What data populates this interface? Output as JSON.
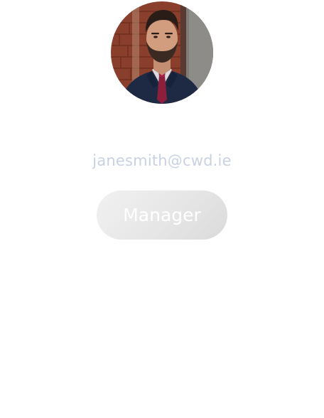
{
  "profile": {
    "avatar_icon": "person-portrait-icon",
    "email": "janesmith@cwd.ie",
    "role_label": "Manager"
  },
  "colors": {
    "email_text": "#c8d2e2",
    "button_text": "#ffffff",
    "button_bg": "#e6e6e6",
    "background": "#ffffff"
  }
}
